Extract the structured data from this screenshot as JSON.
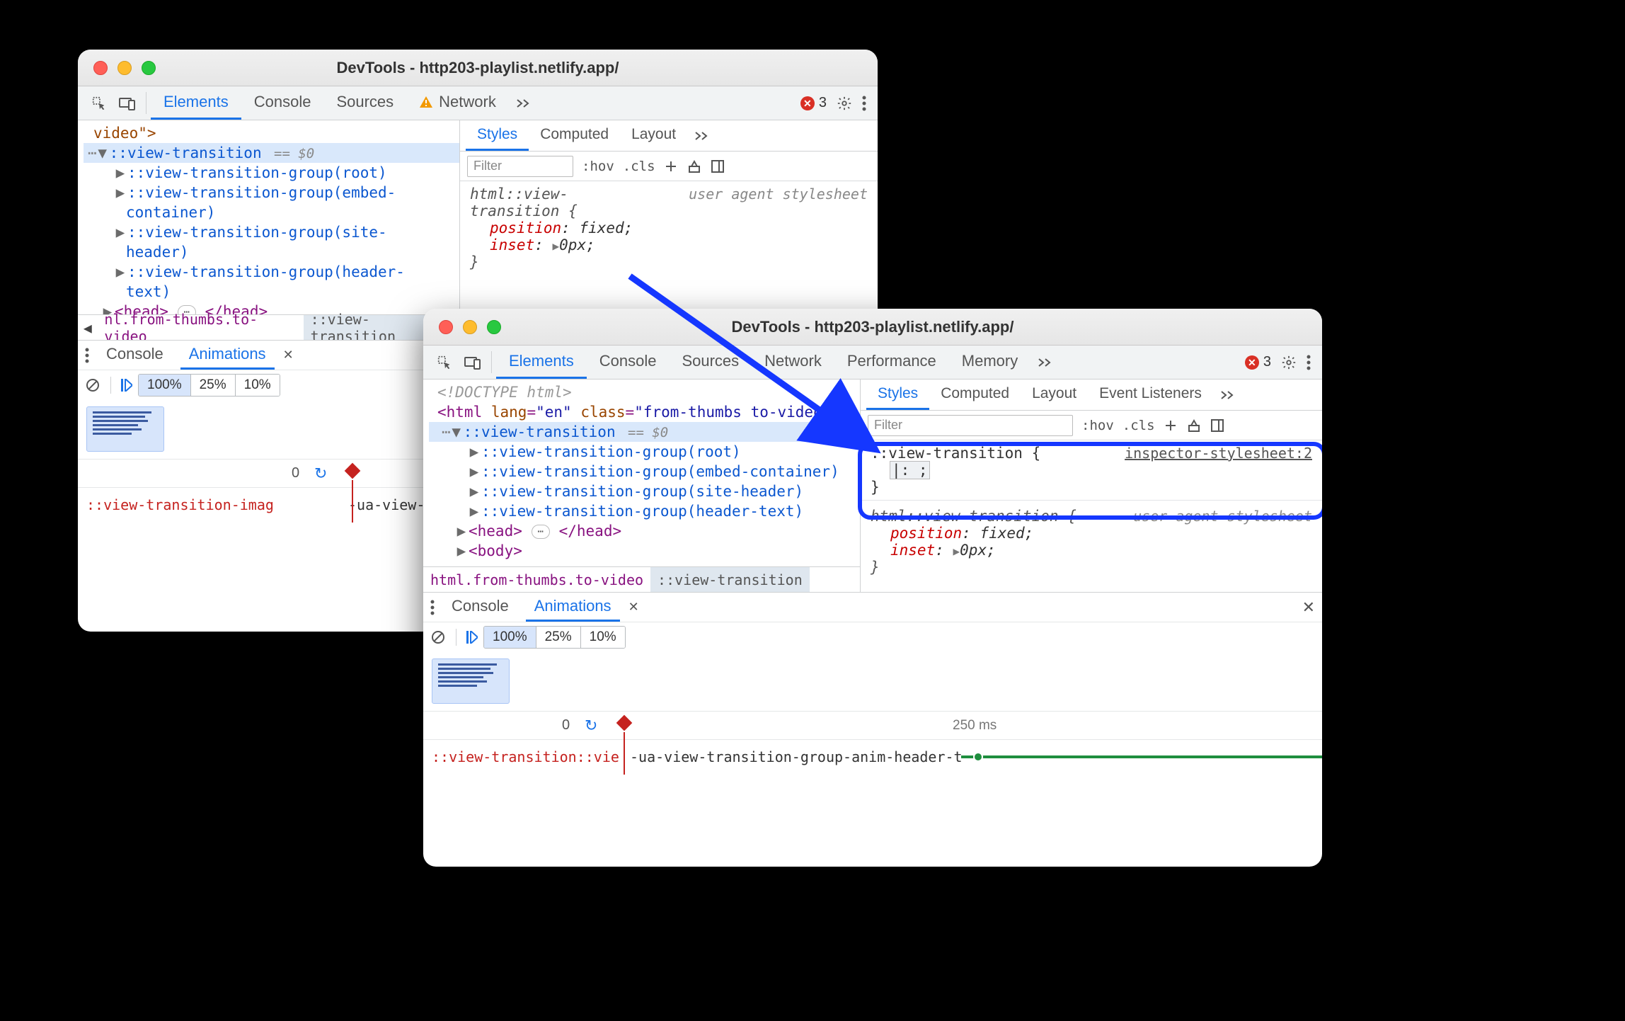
{
  "window1": {
    "title": "DevTools - http203-playlist.netlify.app/",
    "tabs": [
      "Elements",
      "Console",
      "Sources",
      "Network"
    ],
    "network_warn": true,
    "active_tab": "Elements",
    "errors": "3",
    "dom": {
      "line0": "video\">",
      "selected": "::view-transition",
      "selected_suffix": " == $0",
      "g1": "::view-transition-group(root)",
      "g2a": "::view-transition-group(embed-",
      "g2b": "container)",
      "g3a": "::view-transition-group(site-",
      "g3b": "header)",
      "g4a": "::view-transition-group(header-",
      "g4b": "text)",
      "head_open": "<head>",
      "head_close": "</head>"
    },
    "breadcrumb": {
      "left": "nl.from-thumbs.to-video",
      "active": "::view-transition"
    },
    "styles": {
      "tabs": [
        "Styles",
        "Computed",
        "Layout"
      ],
      "filter": "Filter",
      "hov": ":hov",
      "cls": ".cls",
      "rule_sel_a": "html::view-",
      "rule_sel_b": "transition {",
      "src": "user agent stylesheet",
      "p1n": "position",
      "p1v": "fixed",
      "p2n": "inset",
      "p2v": "0px",
      "close": "}"
    },
    "console": {
      "tabs": [
        "Console",
        "Animations"
      ],
      "active": "Animations"
    },
    "speed": {
      "s1": "100%",
      "s2": "25%",
      "s3": "10%"
    },
    "timeline": {
      "zero": "0"
    },
    "track": {
      "label": "::view-transition-imag",
      "name": "-ua-view-tr"
    }
  },
  "window2": {
    "title": "DevTools - http203-playlist.netlify.app/",
    "tabs": [
      "Elements",
      "Console",
      "Sources",
      "Network",
      "Performance",
      "Memory"
    ],
    "active_tab": "Elements",
    "errors": "3",
    "dom": {
      "doctype": "<!DOCTYPE html>",
      "html_open": "<html ",
      "lang_n": "lang",
      "lang_v": "\"en\"",
      "class_n": "class",
      "class_v": "\"from-thumbs to-video\"",
      "html_close": ">",
      "selected": "::view-transition",
      "selected_suffix": " == $0",
      "g1": "::view-transition-group(root)",
      "g2": "::view-transition-group(embed-container)",
      "g3": "::view-transition-group(site-header)",
      "g4": "::view-transition-group(header-text)",
      "head_open": "<head>",
      "head_close": "</head>",
      "body_open": "<body>"
    },
    "breadcrumb": {
      "left": "html.from-thumbs.to-video",
      "active": "::view-transition"
    },
    "styles": {
      "tabs": [
        "Styles",
        "Computed",
        "Layout",
        "Event Listeners"
      ],
      "filter": "Filter",
      "hov": ":hov",
      "cls": ".cls",
      "new_sel": "::view-transition {",
      "new_src": "inspector-stylesheet:2",
      "new_edit": "|:  ;",
      "new_close": "}",
      "rule_sel": "html::view-transition {",
      "src": "user agent stylesheet",
      "p1n": "position",
      "p1v": "fixed",
      "p2n": "inset",
      "p2v": "0px",
      "close": "}"
    },
    "console": {
      "tabs": [
        "Console",
        "Animations"
      ],
      "active": "Animations"
    },
    "speed": {
      "s1": "100%",
      "s2": "25%",
      "s3": "10%"
    },
    "timeline": {
      "zero": "0",
      "t250": "250 ms"
    },
    "track": {
      "label": "::view-transition::vie",
      "name": "-ua-view-transition-group-anim-header-text"
    }
  }
}
